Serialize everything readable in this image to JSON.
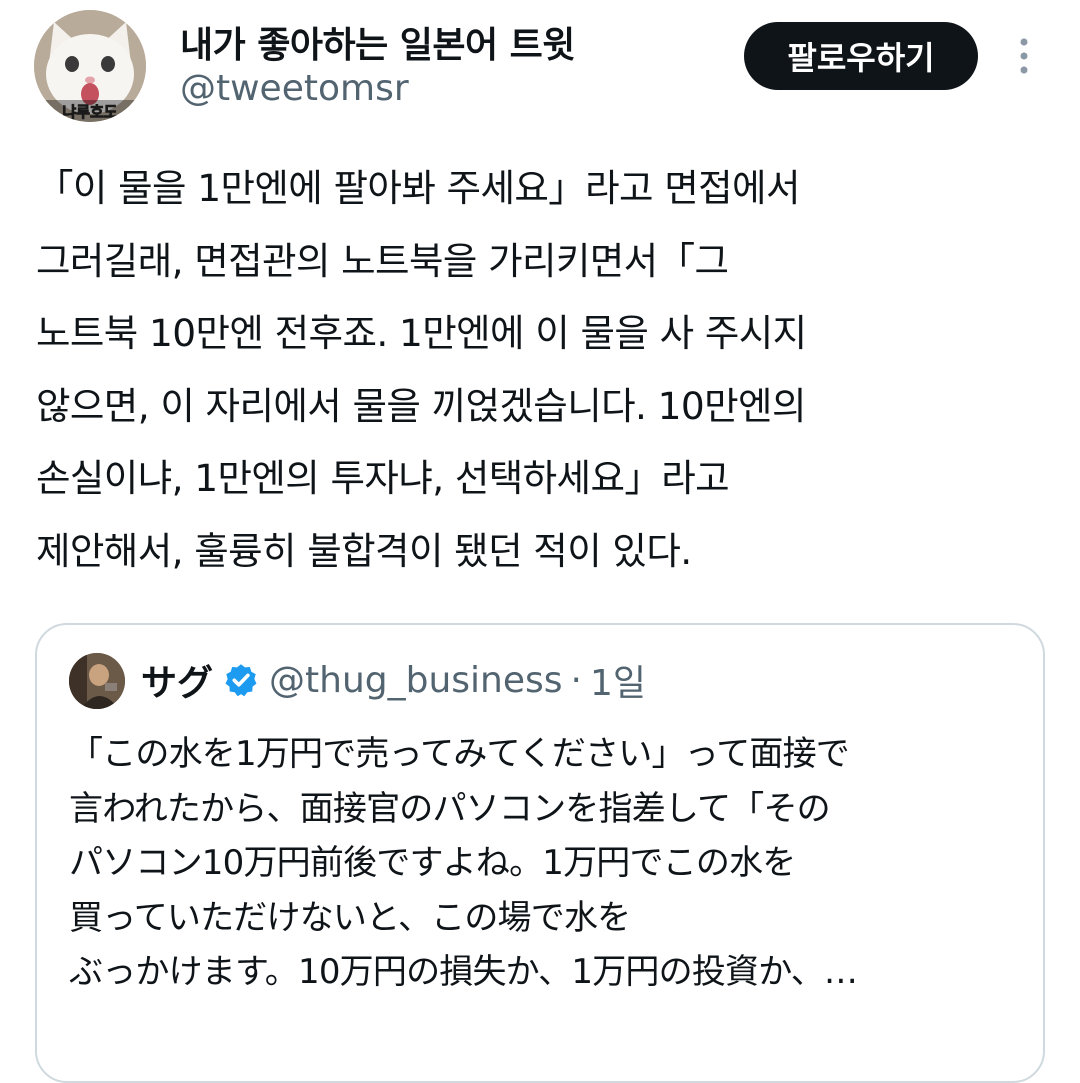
{
  "author": {
    "display_name": "내가 좋아하는 일본어 트윗",
    "handle": "@tweetomsr",
    "avatar_icon": "white-cat-avatar",
    "avatar_caption": "냐루호도"
  },
  "header": {
    "follow_label": "팔로우하기",
    "more_icon": "more-vertical-icon"
  },
  "tweet": {
    "lines": [
      "「이 물을 1만엔에 팔아봐 주세요」라고 면접에서",
      "그러길래, 면접관의 노트북을 가리키면서「그",
      "노트북 10만엔 전후죠. 1만엔에 이 물을 사 주시지",
      "않으면, 이 자리에서 물을 끼얹겠습니다. 10만엔의",
      "손실이냐, 1만엔의 투자냐, 선택하세요」라고",
      "제안해서, 훌륭히 불합격이 됐던 적이 있다."
    ]
  },
  "quote": {
    "display_name": "サグ",
    "verified": true,
    "verified_icon": "verified-badge-icon",
    "handle": "@thug_business",
    "separator": "·",
    "time": "1일",
    "avatar_icon": "user-photo-avatar",
    "lines": [
      "「この水を1万円で売ってみてください」って面接で",
      "言われたから、面接官のパソコンを指差して「その",
      "パソコン10万円前後ですよね。1万円でこの水を",
      "買っていただけないと、この場で水を",
      "ぶっかけます。10万円の損失か、1万円の投資か、…"
    ]
  },
  "colors": {
    "text": "#0f1419",
    "secondary_text": "#536471",
    "follow_button_bg": "#0f1419",
    "follow_button_text": "#ffffff",
    "verified_blue": "#1d9bf0",
    "card_border": "#cfd9de"
  }
}
